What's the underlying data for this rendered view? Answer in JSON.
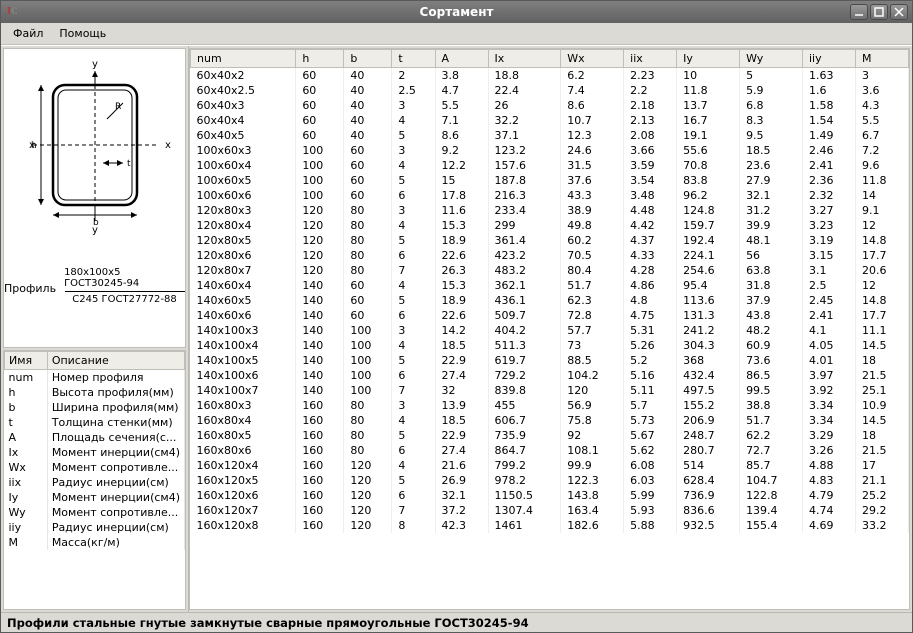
{
  "window": {
    "title": "Сортамент"
  },
  "menu": {
    "file": "Файл",
    "help": "Помощь"
  },
  "profile": {
    "label": "Профиль",
    "top_line": "180x100x5 ГОСТ30245-94",
    "bottom_line": "С245 ГОСТ27772-88"
  },
  "statusbar": "Профили стальные гнутые замкнутые сварные прямоугольные ГОСТ30245-94",
  "desc_table": {
    "headers": [
      "Имя",
      "Описание"
    ],
    "rows": [
      [
        "num",
        "Номер профиля"
      ],
      [
        "h",
        "Высота профиля(мм)"
      ],
      [
        "b",
        "Ширина профиля(мм)"
      ],
      [
        "t",
        "Толщина стенки(мм)"
      ],
      [
        "A",
        "Площадь сечения(с..."
      ],
      [
        "Ix",
        "Момент инерции(см4)"
      ],
      [
        "Wx",
        "Момент сопротивле..."
      ],
      [
        "iix",
        "Радиус инерции(см)"
      ],
      [
        "Iy",
        "Момент инерции(см4)"
      ],
      [
        "Wy",
        "Момент сопротивле..."
      ],
      [
        "iiy",
        "Радиус инерции(см)"
      ],
      [
        "M",
        "Масса(кг/м)"
      ]
    ]
  },
  "main_table": {
    "headers": [
      "num",
      "h",
      "b",
      "t",
      "A",
      "Ix",
      "Wx",
      "iix",
      "Iy",
      "Wy",
      "iiy",
      "M"
    ],
    "rows": [
      [
        "60x40x2",
        "60",
        "40",
        "2",
        "3.8",
        "18.8",
        "6.2",
        "2.23",
        "10",
        "5",
        "1.63",
        "3"
      ],
      [
        "60x40x2.5",
        "60",
        "40",
        "2.5",
        "4.7",
        "22.4",
        "7.4",
        "2.2",
        "11.8",
        "5.9",
        "1.6",
        "3.6"
      ],
      [
        "60x40x3",
        "60",
        "40",
        "3",
        "5.5",
        "26",
        "8.6",
        "2.18",
        "13.7",
        "6.8",
        "1.58",
        "4.3"
      ],
      [
        "60x40x4",
        "60",
        "40",
        "4",
        "7.1",
        "32.2",
        "10.7",
        "2.13",
        "16.7",
        "8.3",
        "1.54",
        "5.5"
      ],
      [
        "60x40x5",
        "60",
        "40",
        "5",
        "8.6",
        "37.1",
        "12.3",
        "2.08",
        "19.1",
        "9.5",
        "1.49",
        "6.7"
      ],
      [
        "100x60x3",
        "100",
        "60",
        "3",
        "9.2",
        "123.2",
        "24.6",
        "3.66",
        "55.6",
        "18.5",
        "2.46",
        "7.2"
      ],
      [
        "100x60x4",
        "100",
        "60",
        "4",
        "12.2",
        "157.6",
        "31.5",
        "3.59",
        "70.8",
        "23.6",
        "2.41",
        "9.6"
      ],
      [
        "100x60x5",
        "100",
        "60",
        "5",
        "15",
        "187.8",
        "37.6",
        "3.54",
        "83.8",
        "27.9",
        "2.36",
        "11.8"
      ],
      [
        "100x60x6",
        "100",
        "60",
        "6",
        "17.8",
        "216.3",
        "43.3",
        "3.48",
        "96.2",
        "32.1",
        "2.32",
        "14"
      ],
      [
        "120x80x3",
        "120",
        "80",
        "3",
        "11.6",
        "233.4",
        "38.9",
        "4.48",
        "124.8",
        "31.2",
        "3.27",
        "9.1"
      ],
      [
        "120x80x4",
        "120",
        "80",
        "4",
        "15.3",
        "299",
        "49.8",
        "4.42",
        "159.7",
        "39.9",
        "3.23",
        "12"
      ],
      [
        "120x80x5",
        "120",
        "80",
        "5",
        "18.9",
        "361.4",
        "60.2",
        "4.37",
        "192.4",
        "48.1",
        "3.19",
        "14.8"
      ],
      [
        "120x80x6",
        "120",
        "80",
        "6",
        "22.6",
        "423.2",
        "70.5",
        "4.33",
        "224.1",
        "56",
        "3.15",
        "17.7"
      ],
      [
        "120x80x7",
        "120",
        "80",
        "7",
        "26.3",
        "483.2",
        "80.4",
        "4.28",
        "254.6",
        "63.8",
        "3.1",
        "20.6"
      ],
      [
        "140x60x4",
        "140",
        "60",
        "4",
        "15.3",
        "362.1",
        "51.7",
        "4.86",
        "95.4",
        "31.8",
        "2.5",
        "12"
      ],
      [
        "140x60x5",
        "140",
        "60",
        "5",
        "18.9",
        "436.1",
        "62.3",
        "4.8",
        "113.6",
        "37.9",
        "2.45",
        "14.8"
      ],
      [
        "140x60x6",
        "140",
        "60",
        "6",
        "22.6",
        "509.7",
        "72.8",
        "4.75",
        "131.3",
        "43.8",
        "2.41",
        "17.7"
      ],
      [
        "140x100x3",
        "140",
        "100",
        "3",
        "14.2",
        "404.2",
        "57.7",
        "5.31",
        "241.2",
        "48.2",
        "4.1",
        "11.1"
      ],
      [
        "140x100x4",
        "140",
        "100",
        "4",
        "18.5",
        "511.3",
        "73",
        "5.26",
        "304.3",
        "60.9",
        "4.05",
        "14.5"
      ],
      [
        "140x100x5",
        "140",
        "100",
        "5",
        "22.9",
        "619.7",
        "88.5",
        "5.2",
        "368",
        "73.6",
        "4.01",
        "18"
      ],
      [
        "140x100x6",
        "140",
        "100",
        "6",
        "27.4",
        "729.2",
        "104.2",
        "5.16",
        "432.4",
        "86.5",
        "3.97",
        "21.5"
      ],
      [
        "140x100x7",
        "140",
        "100",
        "7",
        "32",
        "839.8",
        "120",
        "5.11",
        "497.5",
        "99.5",
        "3.92",
        "25.1"
      ],
      [
        "160x80x3",
        "160",
        "80",
        "3",
        "13.9",
        "455",
        "56.9",
        "5.7",
        "155.2",
        "38.8",
        "3.34",
        "10.9"
      ],
      [
        "160x80x4",
        "160",
        "80",
        "4",
        "18.5",
        "606.7",
        "75.8",
        "5.73",
        "206.9",
        "51.7",
        "3.34",
        "14.5"
      ],
      [
        "160x80x5",
        "160",
        "80",
        "5",
        "22.9",
        "735.9",
        "92",
        "5.67",
        "248.7",
        "62.2",
        "3.29",
        "18"
      ],
      [
        "160x80x6",
        "160",
        "80",
        "6",
        "27.4",
        "864.7",
        "108.1",
        "5.62",
        "280.7",
        "72.7",
        "3.26",
        "21.5"
      ],
      [
        "160x120x4",
        "160",
        "120",
        "4",
        "21.6",
        "799.2",
        "99.9",
        "6.08",
        "514",
        "85.7",
        "4.88",
        "17"
      ],
      [
        "160x120x5",
        "160",
        "120",
        "5",
        "26.9",
        "978.2",
        "122.3",
        "6.03",
        "628.4",
        "104.7",
        "4.83",
        "21.1"
      ],
      [
        "160x120x6",
        "160",
        "120",
        "6",
        "32.1",
        "1150.5",
        "143.8",
        "5.99",
        "736.9",
        "122.8",
        "4.79",
        "25.2"
      ],
      [
        "160x120x7",
        "160",
        "120",
        "7",
        "37.2",
        "1307.4",
        "163.4",
        "5.93",
        "836.6",
        "139.4",
        "4.74",
        "29.2"
      ],
      [
        "160x120x8",
        "160",
        "120",
        "8",
        "42.3",
        "1461",
        "182.6",
        "5.88",
        "932.5",
        "155.4",
        "4.69",
        "33.2"
      ]
    ]
  }
}
